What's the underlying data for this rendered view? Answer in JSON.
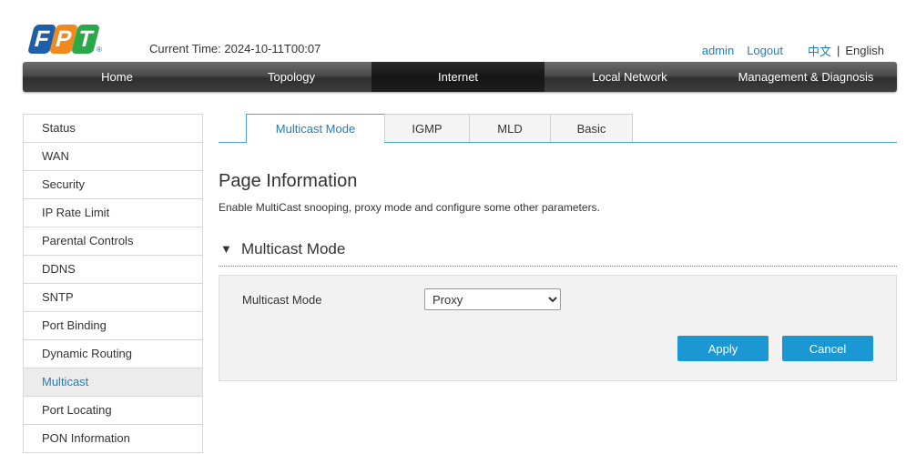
{
  "brand": {
    "logo_letters": [
      "F",
      "P",
      "T"
    ],
    "logo_colors": [
      "#1f5fa8",
      "#f08a1d",
      "#2aa84a"
    ],
    "registered": "®"
  },
  "header": {
    "current_time_label": "Current Time:",
    "current_time_value": "2024-10-11T00:07",
    "user_link": "admin",
    "logout_link": "Logout",
    "lang_cn": "中文",
    "lang_sep": "|",
    "lang_en": "English"
  },
  "nav": {
    "items": [
      {
        "label": "Home"
      },
      {
        "label": "Topology"
      },
      {
        "label": "Internet"
      },
      {
        "label": "Local Network"
      },
      {
        "label": "Management & Diagnosis"
      }
    ],
    "active": "Internet"
  },
  "sidebar": {
    "items": [
      {
        "label": "Status"
      },
      {
        "label": "WAN"
      },
      {
        "label": "Security"
      },
      {
        "label": "IP Rate Limit"
      },
      {
        "label": "Parental Controls"
      },
      {
        "label": "DDNS"
      },
      {
        "label": "SNTP"
      },
      {
        "label": "Port Binding"
      },
      {
        "label": "Dynamic Routing"
      },
      {
        "label": "Multicast"
      },
      {
        "label": "Port Locating"
      },
      {
        "label": "PON Information"
      }
    ],
    "active": "Multicast"
  },
  "tabs": {
    "items": [
      {
        "label": "Multicast Mode"
      },
      {
        "label": "IGMP"
      },
      {
        "label": "MLD"
      },
      {
        "label": "Basic"
      }
    ],
    "active": "Multicast Mode"
  },
  "page": {
    "title": "Page Information",
    "description": "Enable MultiCast snooping, proxy mode and configure some other parameters."
  },
  "section": {
    "title": "Multicast Mode",
    "collapse_glyph": "▼"
  },
  "form": {
    "multicast_mode_label": "Multicast Mode",
    "multicast_mode_value": "Proxy"
  },
  "buttons": {
    "apply": "Apply",
    "cancel": "Cancel"
  },
  "colors": {
    "accent": "#1f7fb8",
    "button": "#1b97d4",
    "nav_dark": "#2e2e2e"
  }
}
